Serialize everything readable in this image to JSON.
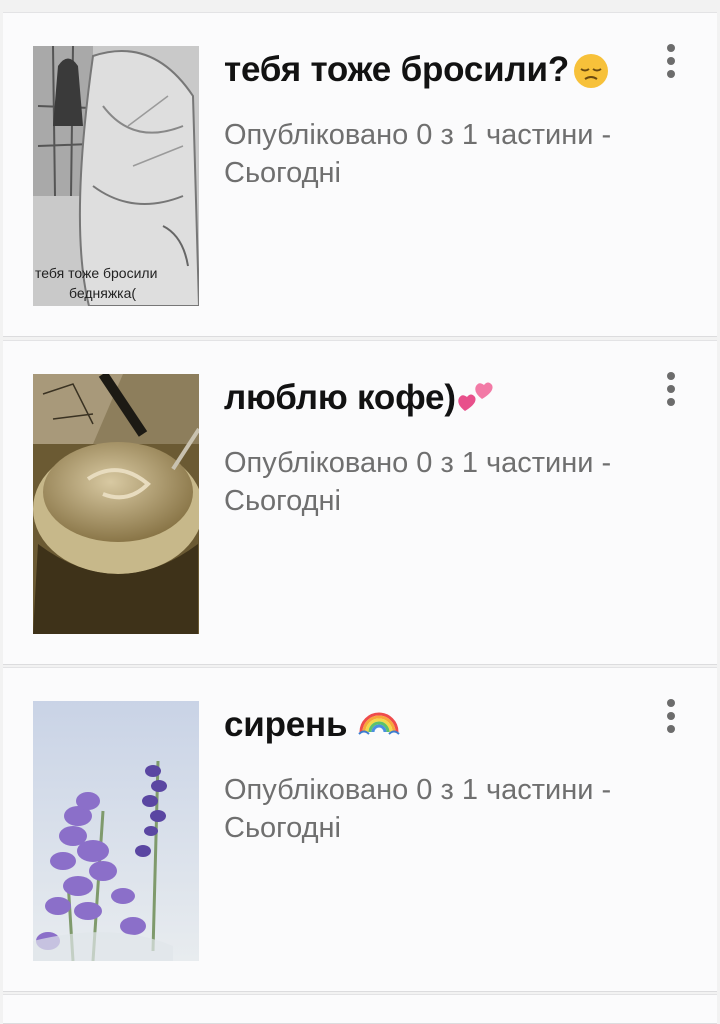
{
  "stories": [
    {
      "title": "тебя тоже бросили?",
      "title_emoji_icon": "pensive-face-icon",
      "status": "Опубліковано 0 з 1 частини -",
      "date": "Сьогодні",
      "cover_caption_line1": "тебя тоже бросили",
      "cover_caption_line2": "бедняжка("
    },
    {
      "title": "люблю кофе)",
      "title_emoji_icon": "two-hearts-icon",
      "status": "Опубліковано 0 з 1 частини -",
      "date": "Сьогодні"
    },
    {
      "title": "сирень ",
      "title_emoji_icon": "rainbow-icon",
      "status": "Опубліковано 0 з 1 частини -",
      "date": "Сьогодні"
    }
  ],
  "menu_icon": "more-vertical-icon",
  "colors": {
    "title": "#121212",
    "meta": "#6f6f6f",
    "card_background": "#fbfbfc",
    "page_background": "#f2f2f2",
    "menu_dots": "#6c6c6c"
  }
}
